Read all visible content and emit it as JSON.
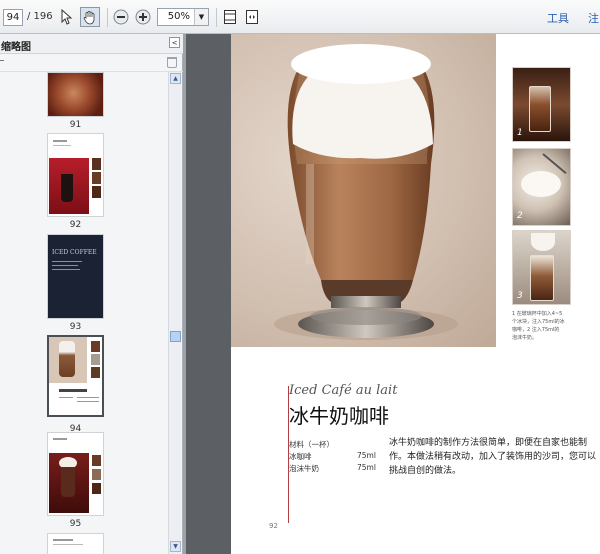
{
  "toolbar": {
    "page_current": "94",
    "page_total": "/ 196",
    "zoom": "50%",
    "tools_label": "工具",
    "comment_label": "注"
  },
  "sidebar": {
    "title": "缩略图",
    "thumbnails": [
      {
        "page": "91",
        "selected": false
      },
      {
        "page": "92",
        "selected": false
      },
      {
        "page": "93",
        "selected": false,
        "text": "ICED COFFEE"
      },
      {
        "page": "94",
        "selected": true
      },
      {
        "page": "95",
        "selected": false
      }
    ]
  },
  "document": {
    "subtitle": "Iced Café au lait",
    "title": "冰牛奶咖啡",
    "ingredients_header": "材料（一杯）",
    "ingredients": [
      {
        "name": "冰咖啡",
        "qty": "75ml"
      },
      {
        "name": "泡沫牛奶",
        "qty": "75ml"
      }
    ],
    "body": "冰牛奶咖啡的制作方法很简单，即便在自家也能制作。本做法稍有改动，加入了装饰用的沙司，您可以挑战自创的做法。",
    "step_numbers": [
      "1",
      "2",
      "3"
    ],
    "step_caption": "1 在玻璃杯中加入4~5\n个冰块，注入75ml的冰\n咖啡，2 注入75ml的\n泡沫牛奶。",
    "page_number": "92"
  }
}
